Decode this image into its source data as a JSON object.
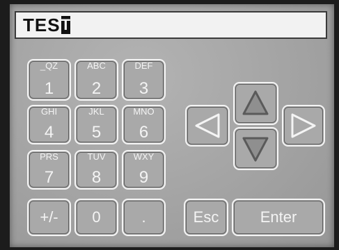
{
  "display": {
    "text": "TES",
    "cursor_char": "T"
  },
  "keypad": {
    "keys": [
      {
        "sub": "_QZ",
        "main": "1"
      },
      {
        "sub": "ABC",
        "main": "2"
      },
      {
        "sub": "DEF",
        "main": "3"
      },
      {
        "sub": "GHI",
        "main": "4"
      },
      {
        "sub": "JKL",
        "main": "5"
      },
      {
        "sub": "MNO",
        "main": "6"
      },
      {
        "sub": "PRS",
        "main": "7"
      },
      {
        "sub": "TUV",
        "main": "8"
      },
      {
        "sub": "WXY",
        "main": "9"
      }
    ],
    "bottom": {
      "plus_minus": "+/-",
      "zero": "0",
      "dot": "."
    }
  },
  "controls": {
    "esc": "Esc",
    "enter": "Enter"
  },
  "icons": [
    "arrow-up-icon",
    "arrow-down-icon",
    "arrow-left-icon",
    "arrow-right-icon"
  ],
  "colors": {
    "panel": "#a7a7a7",
    "key_border": "#f4f4f4",
    "display_bg": "#f2f2f2"
  }
}
